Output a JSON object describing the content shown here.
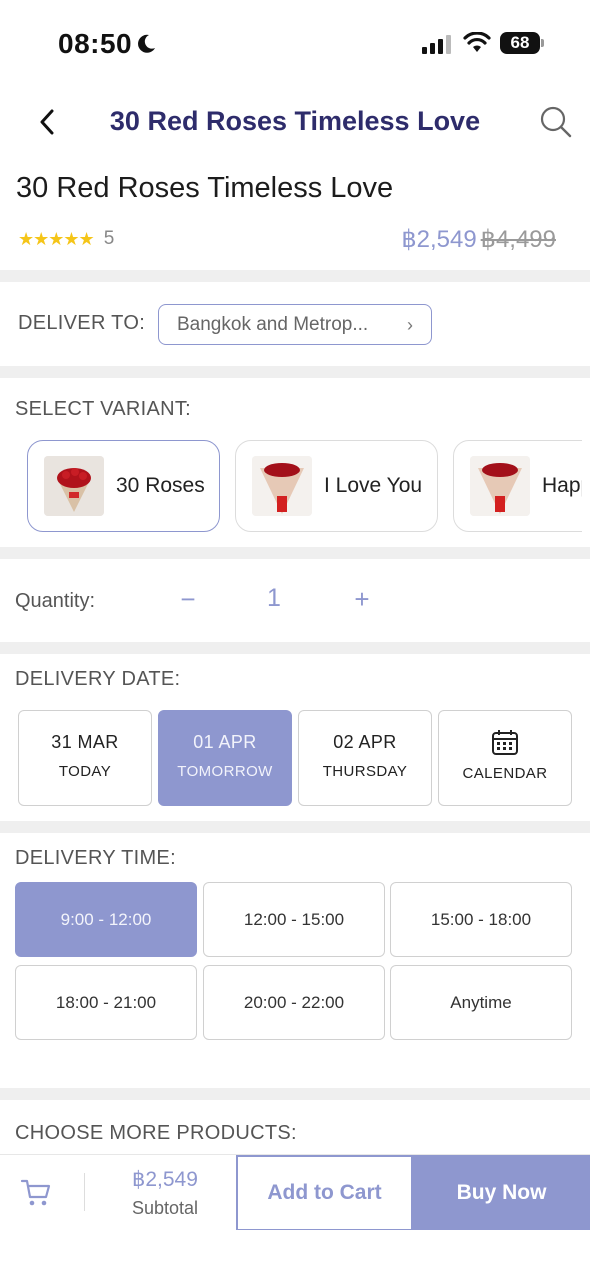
{
  "status_bar": {
    "time": "08:50",
    "battery": "68"
  },
  "nav": {
    "title": "30 Red Roses Timeless Love"
  },
  "product": {
    "title": "30 Red Roses Timeless Love",
    "stars": "★★★★★",
    "rating_count": "5",
    "price": "฿2,549",
    "old_price": "฿4,499"
  },
  "delivery_location": {
    "label": "DELIVER TO:",
    "value": "Bangkok and Metrop...",
    "chevron": "›"
  },
  "variants": {
    "label": "SELECT VARIANT:",
    "items": [
      {
        "label": "30 Roses",
        "selected": true
      },
      {
        "label": "I Love You",
        "selected": false
      },
      {
        "label": "Happ",
        "selected": false
      }
    ]
  },
  "quantity": {
    "label": "Quantity:",
    "minus": "−",
    "value": "1",
    "plus": "+"
  },
  "delivery_date": {
    "label": "DELIVERY DATE:",
    "options": [
      {
        "date": "31 MAR",
        "day": "TODAY",
        "selected": false
      },
      {
        "date": "01 APR",
        "day": "TOMORROW",
        "selected": true
      },
      {
        "date": "02 APR",
        "day": "THURSDAY",
        "selected": false
      },
      {
        "date": "",
        "day": "CALENDAR",
        "icon": "calendar-icon",
        "selected": false
      }
    ]
  },
  "delivery_time": {
    "label": "DELIVERY TIME:",
    "options": [
      {
        "label": "9:00 - 12:00",
        "selected": true
      },
      {
        "label": "12:00 - 15:00",
        "selected": false
      },
      {
        "label": "15:00 - 18:00",
        "selected": false
      },
      {
        "label": "18:00 - 21:00",
        "selected": false
      },
      {
        "label": "20:00 - 22:00",
        "selected": false
      },
      {
        "label": "Anytime",
        "selected": false
      }
    ]
  },
  "more_products": {
    "label": "CHOOSE MORE PRODUCTS:"
  },
  "bottom_bar": {
    "subtotal_price": "฿2,549",
    "subtotal_label": "Subtotal",
    "add_to_cart": "Add to Cart",
    "buy_now": "Buy Now"
  },
  "colors": {
    "accent": "#8e97cf",
    "title": "#2e2c6b",
    "star": "#f5c518",
    "divider": "#efefef"
  }
}
